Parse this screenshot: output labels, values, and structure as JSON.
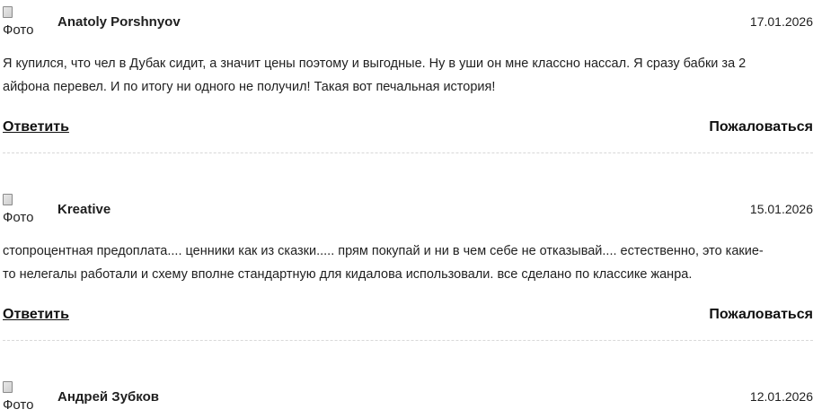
{
  "avatar_alt": "Фото аватар",
  "comments": [
    {
      "author": "Anatoly Porshnyov",
      "date": "17.01.2026",
      "text_lines": [
        "Я купился, что чел в Дубак сидит, а значит цены поэтому и выгодные. Ну в уши он мне классно нассал. Я сразу бабки за 2",
        "айфона перевел. И по итогу ни одного не получил! Такая вот печальная история!"
      ],
      "reply_label": "Ответить",
      "report_label": "Пожаловаться"
    },
    {
      "author": "Kreative",
      "date": "15.01.2026",
      "text_lines": [
        "стопроцентная предоплата.... ценники как из сказки..... прям покупай и ни в чем себе не отказывай.... естественно, это какие-",
        "то нелегалы работали и схему вполне стандартную для кидалова использовали. все сделано по классике жанра."
      ],
      "reply_label": "Ответить",
      "report_label": "Пожаловаться"
    },
    {
      "author": "Андрей Зубков",
      "date": "12.01.2026"
    }
  ]
}
